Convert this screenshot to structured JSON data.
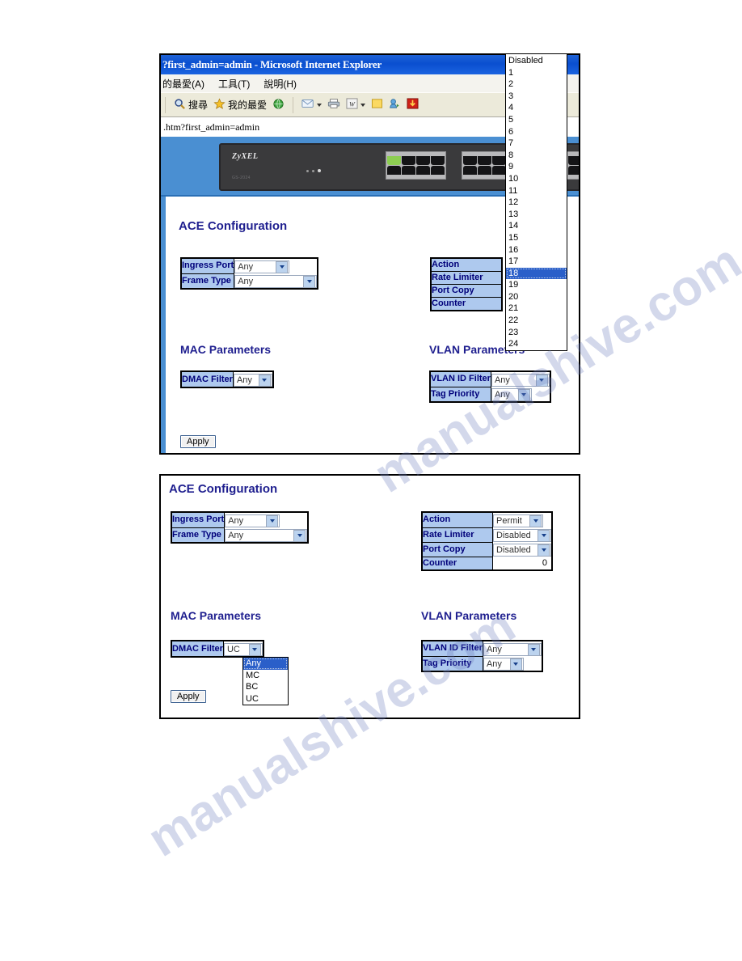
{
  "browser": {
    "title": "?first_admin=admin - Microsoft Internet Explorer",
    "menu": [
      "的最愛(A)",
      "工具(T)",
      "說明(H)"
    ],
    "toolbar": [
      {
        "icon": "search-icon",
        "label": "搜尋"
      },
      {
        "icon": "star-icon",
        "label": "我的最愛"
      },
      {
        "icon": "history-globe-icon",
        "label": ""
      },
      {
        "icon": "mail-icon",
        "label": ""
      },
      {
        "icon": "print-icon",
        "label": ""
      },
      {
        "icon": "edit-word-icon",
        "label": ""
      },
      {
        "icon": "note-icon",
        "label": ""
      },
      {
        "icon": "messenger-icon",
        "label": ""
      },
      {
        "icon": "download-icon",
        "label": ""
      }
    ],
    "address": ".htm?first_admin=admin"
  },
  "device": {
    "brand": "ZyXEL",
    "model": "GS-2024",
    "active_port": 1,
    "port_count": 24
  },
  "port_dropdown": {
    "name": "ingress-port-option-list",
    "selected": "18",
    "options": [
      "Disabled",
      "1",
      "2",
      "3",
      "4",
      "5",
      "6",
      "7",
      "8",
      "9",
      "10",
      "11",
      "12",
      "13",
      "14",
      "15",
      "16",
      "17",
      "18",
      "19",
      "20",
      "21",
      "22",
      "23",
      "24"
    ]
  },
  "dmac_dropdown": {
    "name": "dmac-filter-option-list",
    "selected": "Any",
    "options": [
      "Any",
      "MC",
      "BC",
      "UC"
    ]
  },
  "panel_top": {
    "heading": "ACE Configuration",
    "left_rows": [
      {
        "label": "Ingress Port",
        "value": "Any"
      },
      {
        "label": "Frame Type",
        "value": "Any"
      }
    ],
    "right_rows": [
      {
        "label": "Action",
        "value": ""
      },
      {
        "label": "Rate Limiter",
        "value": ""
      },
      {
        "label": "Port Copy",
        "value": ""
      },
      {
        "label": "Counter",
        "value": ""
      }
    ],
    "mac_heading": "MAC Parameters",
    "mac_rows": [
      {
        "label": "DMAC Filter",
        "value": "Any"
      }
    ],
    "vlan_heading": "VLAN Parameters",
    "vlan_rows": [
      {
        "label": "VLAN ID Filter",
        "value": "Any"
      },
      {
        "label": "Tag Priority",
        "value": "Any"
      }
    ],
    "apply_label": "Apply"
  },
  "panel_bottom": {
    "heading": "ACE Configuration",
    "left_rows": [
      {
        "label": "Ingress Port",
        "value": "Any"
      },
      {
        "label": "Frame Type",
        "value": "Any"
      }
    ],
    "right_rows": [
      {
        "label": "Action",
        "value": "Permit",
        "type": "select"
      },
      {
        "label": "Rate Limiter",
        "value": "Disabled",
        "type": "select"
      },
      {
        "label": "Port Copy",
        "value": "Disabled",
        "type": "select"
      },
      {
        "label": "Counter",
        "value": "0",
        "type": "text"
      }
    ],
    "mac_heading": "MAC Parameters",
    "mac_rows": [
      {
        "label": "DMAC Filter",
        "value": "UC"
      }
    ],
    "vlan_heading": "VLAN Parameters",
    "vlan_rows": [
      {
        "label": "VLAN ID Filter",
        "value": "Any"
      },
      {
        "label": "Tag Priority",
        "value": "Any"
      }
    ],
    "apply_label": "Apply"
  },
  "watermark": {
    "line1": "manualshive.com",
    "line2": "manualshive.com"
  },
  "colors": {
    "label_blue": "#aec9ee",
    "heading_blue": "#1f1f8f",
    "title_bar": "#0a4fd0",
    "selection": "#2a5fc9",
    "banner": "#4a8fd2"
  }
}
